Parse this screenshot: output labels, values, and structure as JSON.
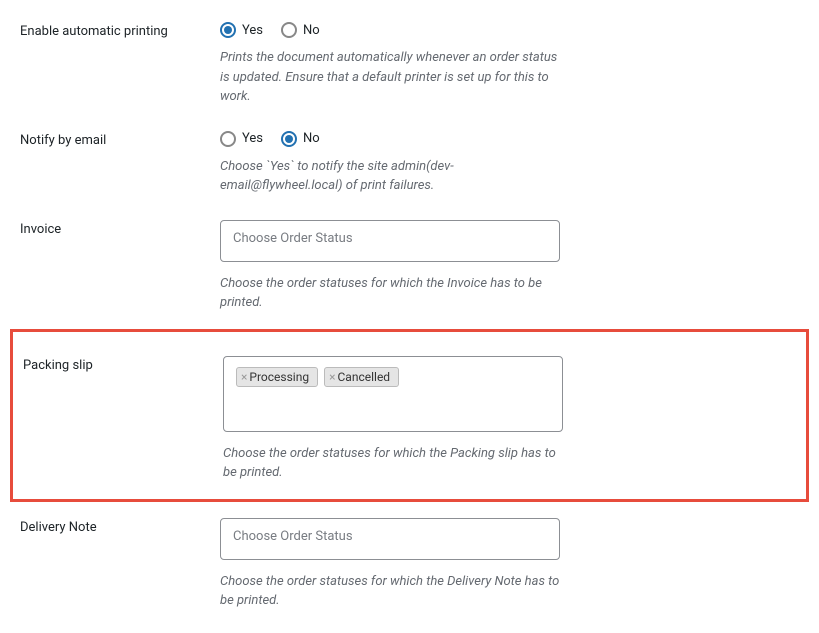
{
  "autoPrint": {
    "label": "Enable automatic printing",
    "yes": "Yes",
    "no": "No",
    "selected": "yes",
    "help": "Prints the document automatically whenever an order status is updated. Ensure that a default printer is set up for this to work."
  },
  "notify": {
    "label": "Notify by email",
    "yes": "Yes",
    "no": "No",
    "selected": "no",
    "help": "Choose `Yes` to notify the site admin(dev-email@flywheel.local) of print failures."
  },
  "invoice": {
    "label": "Invoice",
    "placeholder": "Choose Order Status",
    "help": "Choose the order statuses for which the Invoice has to be printed."
  },
  "packingSlip": {
    "label": "Packing slip",
    "tags": [
      "Processing",
      "Cancelled"
    ],
    "help": "Choose the order statuses for which the Packing slip has to be printed."
  },
  "deliveryNote": {
    "label": "Delivery Note",
    "placeholder": "Choose Order Status",
    "help": "Choose the order statuses for which the Delivery Note has to be printed."
  }
}
